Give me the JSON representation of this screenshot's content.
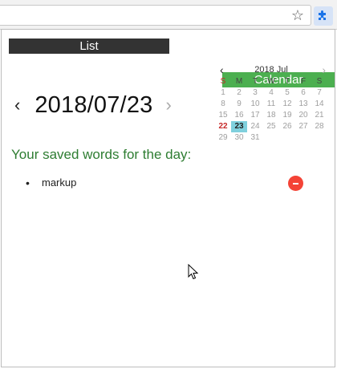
{
  "browser": {
    "star_icon": "star-icon",
    "extension_icon": "puzzle-icon"
  },
  "tabs": [
    {
      "label": "Calendar",
      "active": true,
      "color": "#4caf50"
    },
    {
      "label": "List",
      "active": false,
      "color": "#333333"
    }
  ],
  "day_nav": {
    "prev": "‹",
    "date": "2018/07/23",
    "next": "›"
  },
  "mini_calendar": {
    "prev": "‹",
    "title": "2018 Jul",
    "next": "›",
    "weekdays": [
      "S",
      "M",
      "T",
      "W",
      "T",
      "F",
      "S"
    ],
    "days": [
      "1",
      "2",
      "3",
      "4",
      "5",
      "6",
      "7",
      "8",
      "9",
      "10",
      "11",
      "12",
      "13",
      "14",
      "15",
      "16",
      "17",
      "18",
      "19",
      "20",
      "21",
      "22",
      "23",
      "24",
      "25",
      "26",
      "27",
      "28",
      "29",
      "30",
      "31"
    ],
    "today": "22",
    "selected": "23",
    "selected_color": "#7fd0dd"
  },
  "saved": {
    "heading": "Your saved words for the day:",
    "words": [
      {
        "bullet": "•",
        "text": "markup"
      }
    ],
    "remove_color": "#f44336"
  }
}
